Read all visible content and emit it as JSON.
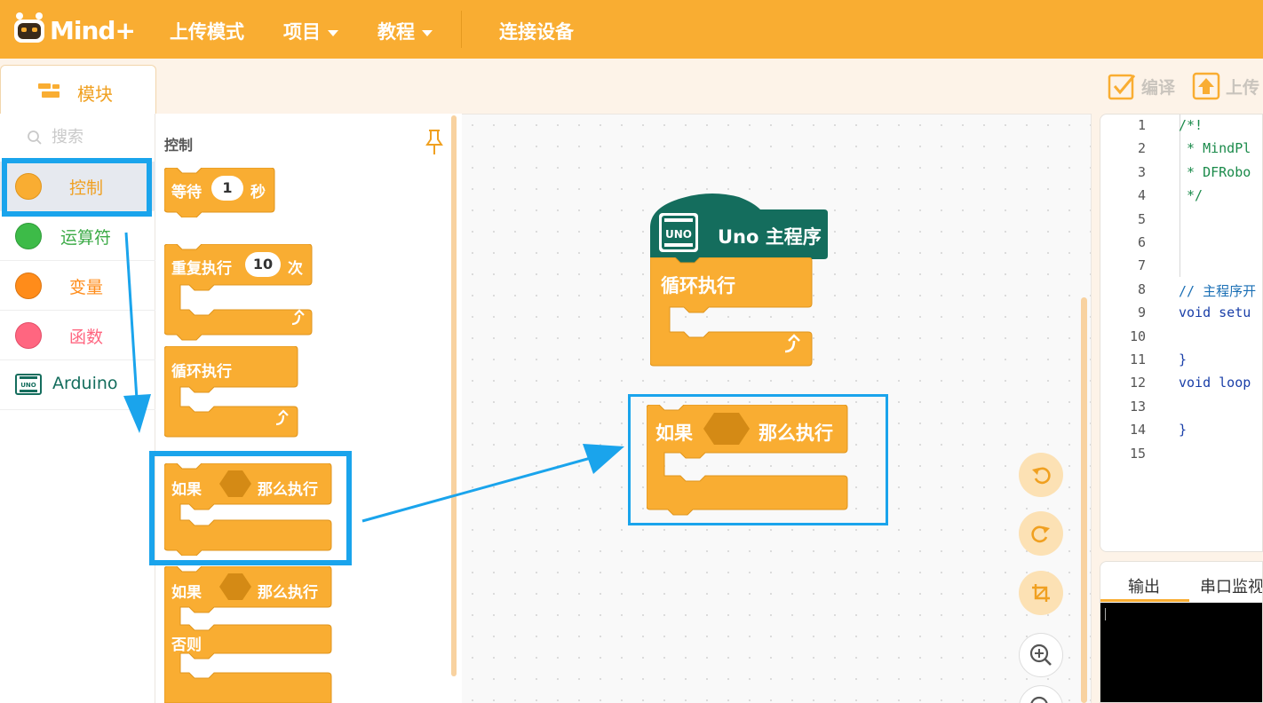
{
  "header": {
    "logo_text": "Mind+",
    "menu": [
      {
        "label": "上传模式"
      },
      {
        "label": "项目"
      },
      {
        "label": "教程"
      },
      {
        "label": "连接设备"
      }
    ]
  },
  "tabs": {
    "modules_label": "模块"
  },
  "toolbar": {
    "compile_label": "编译",
    "upload_label": "上传"
  },
  "sidebar": {
    "search_placeholder": "搜索",
    "categories": [
      {
        "label": "控制",
        "color": "#f9ad32"
      },
      {
        "label": "运算符",
        "color": "#3dbb48"
      },
      {
        "label": "变量",
        "color": "#ff8c1a"
      },
      {
        "label": "函数",
        "color": "#ff6680"
      },
      {
        "label": "Arduino",
        "color": "#146d5d"
      }
    ]
  },
  "palette": {
    "title": "控制",
    "blocks": {
      "wait": {
        "label": "等待",
        "value": "1",
        "unit": "秒"
      },
      "repeat": {
        "label": "重复执行",
        "value": "10",
        "unit": "次"
      },
      "forever": {
        "label": "循环执行"
      },
      "if_then": {
        "if_label": "如果",
        "then_label": "那么执行"
      },
      "if_else": {
        "if_label": "如果",
        "then_label": "那么执行",
        "else_label": "否则"
      }
    }
  },
  "workspace": {
    "main_hat": {
      "label": "Uno 主程序",
      "board_badge": "UNO"
    },
    "main_loop": {
      "label": "循环执行"
    },
    "if_block": {
      "if_label": "如果",
      "then_label": "那么执行"
    }
  },
  "code": {
    "line_numbers": [
      "1",
      "2",
      "3",
      "4",
      "5",
      "6",
      "7",
      "8",
      "9",
      "10",
      "11",
      "12",
      "13",
      "14",
      "15"
    ],
    "lines": [
      "/*!",
      " * MindPl",
      " * DFRobo",
      " */",
      "",
      "",
      "",
      "// 主程序开",
      "void setu",
      "",
      "}",
      "void loop",
      "",
      "}",
      ""
    ]
  },
  "output": {
    "tab_output": "输出",
    "tab_serial": "串口监视"
  },
  "colors": {
    "accent": "#f9ad32",
    "block": "#f9ad32",
    "block_dark": "#d48a15",
    "arduino_green": "#146d5d",
    "highlight": "#1aa4ec"
  }
}
